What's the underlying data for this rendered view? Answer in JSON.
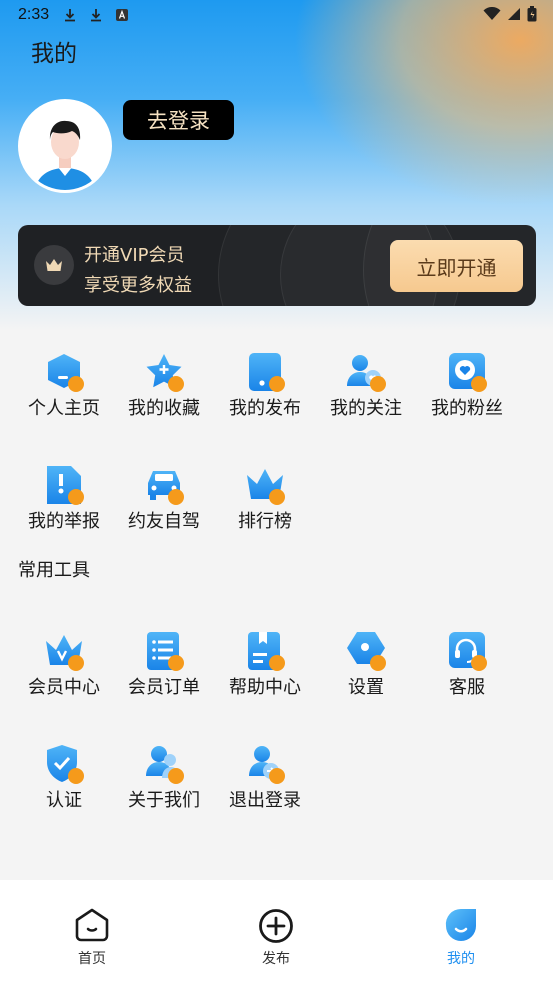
{
  "status_bar": {
    "time": "2:33"
  },
  "header": {
    "title": "我的"
  },
  "profile": {
    "login_label": "去登录"
  },
  "vip": {
    "line1": "开通VIP会员",
    "line2": "享受更多权益",
    "button_label": "立即开通"
  },
  "menu": {
    "items": [
      {
        "label": "个人主页",
        "icon": "home-page-icon"
      },
      {
        "label": "我的收藏",
        "icon": "star-icon"
      },
      {
        "label": "我的发布",
        "icon": "phone-icon"
      },
      {
        "label": "我的关注",
        "icon": "follow-user-icon"
      },
      {
        "label": "我的粉丝",
        "icon": "heart-icon"
      },
      {
        "label": "我的举报",
        "icon": "report-icon"
      },
      {
        "label": "约友自驾",
        "icon": "car-icon"
      },
      {
        "label": "排行榜",
        "icon": "crown-icon"
      }
    ]
  },
  "tools": {
    "title": "常用工具",
    "items": [
      {
        "label": "会员中心",
        "icon": "vip-crown-icon"
      },
      {
        "label": "会员订单",
        "icon": "order-list-icon"
      },
      {
        "label": "帮助中心",
        "icon": "help-book-icon"
      },
      {
        "label": "设置",
        "icon": "settings-icon"
      },
      {
        "label": "客服",
        "icon": "headset-icon"
      },
      {
        "label": "认证",
        "icon": "shield-check-icon"
      },
      {
        "label": "关于我们",
        "icon": "users-icon"
      },
      {
        "label": "退出登录",
        "icon": "logout-user-icon"
      }
    ]
  },
  "tabbar": {
    "items": [
      {
        "label": "首页",
        "icon": "home-icon",
        "active": false
      },
      {
        "label": "发布",
        "icon": "plus-circle-icon",
        "active": false
      },
      {
        "label": "我的",
        "icon": "profile-icon",
        "active": true
      }
    ]
  },
  "colors": {
    "accent": "#1e8ff0",
    "badge": "#f59a1b",
    "vip_text": "#f0d9b5"
  }
}
